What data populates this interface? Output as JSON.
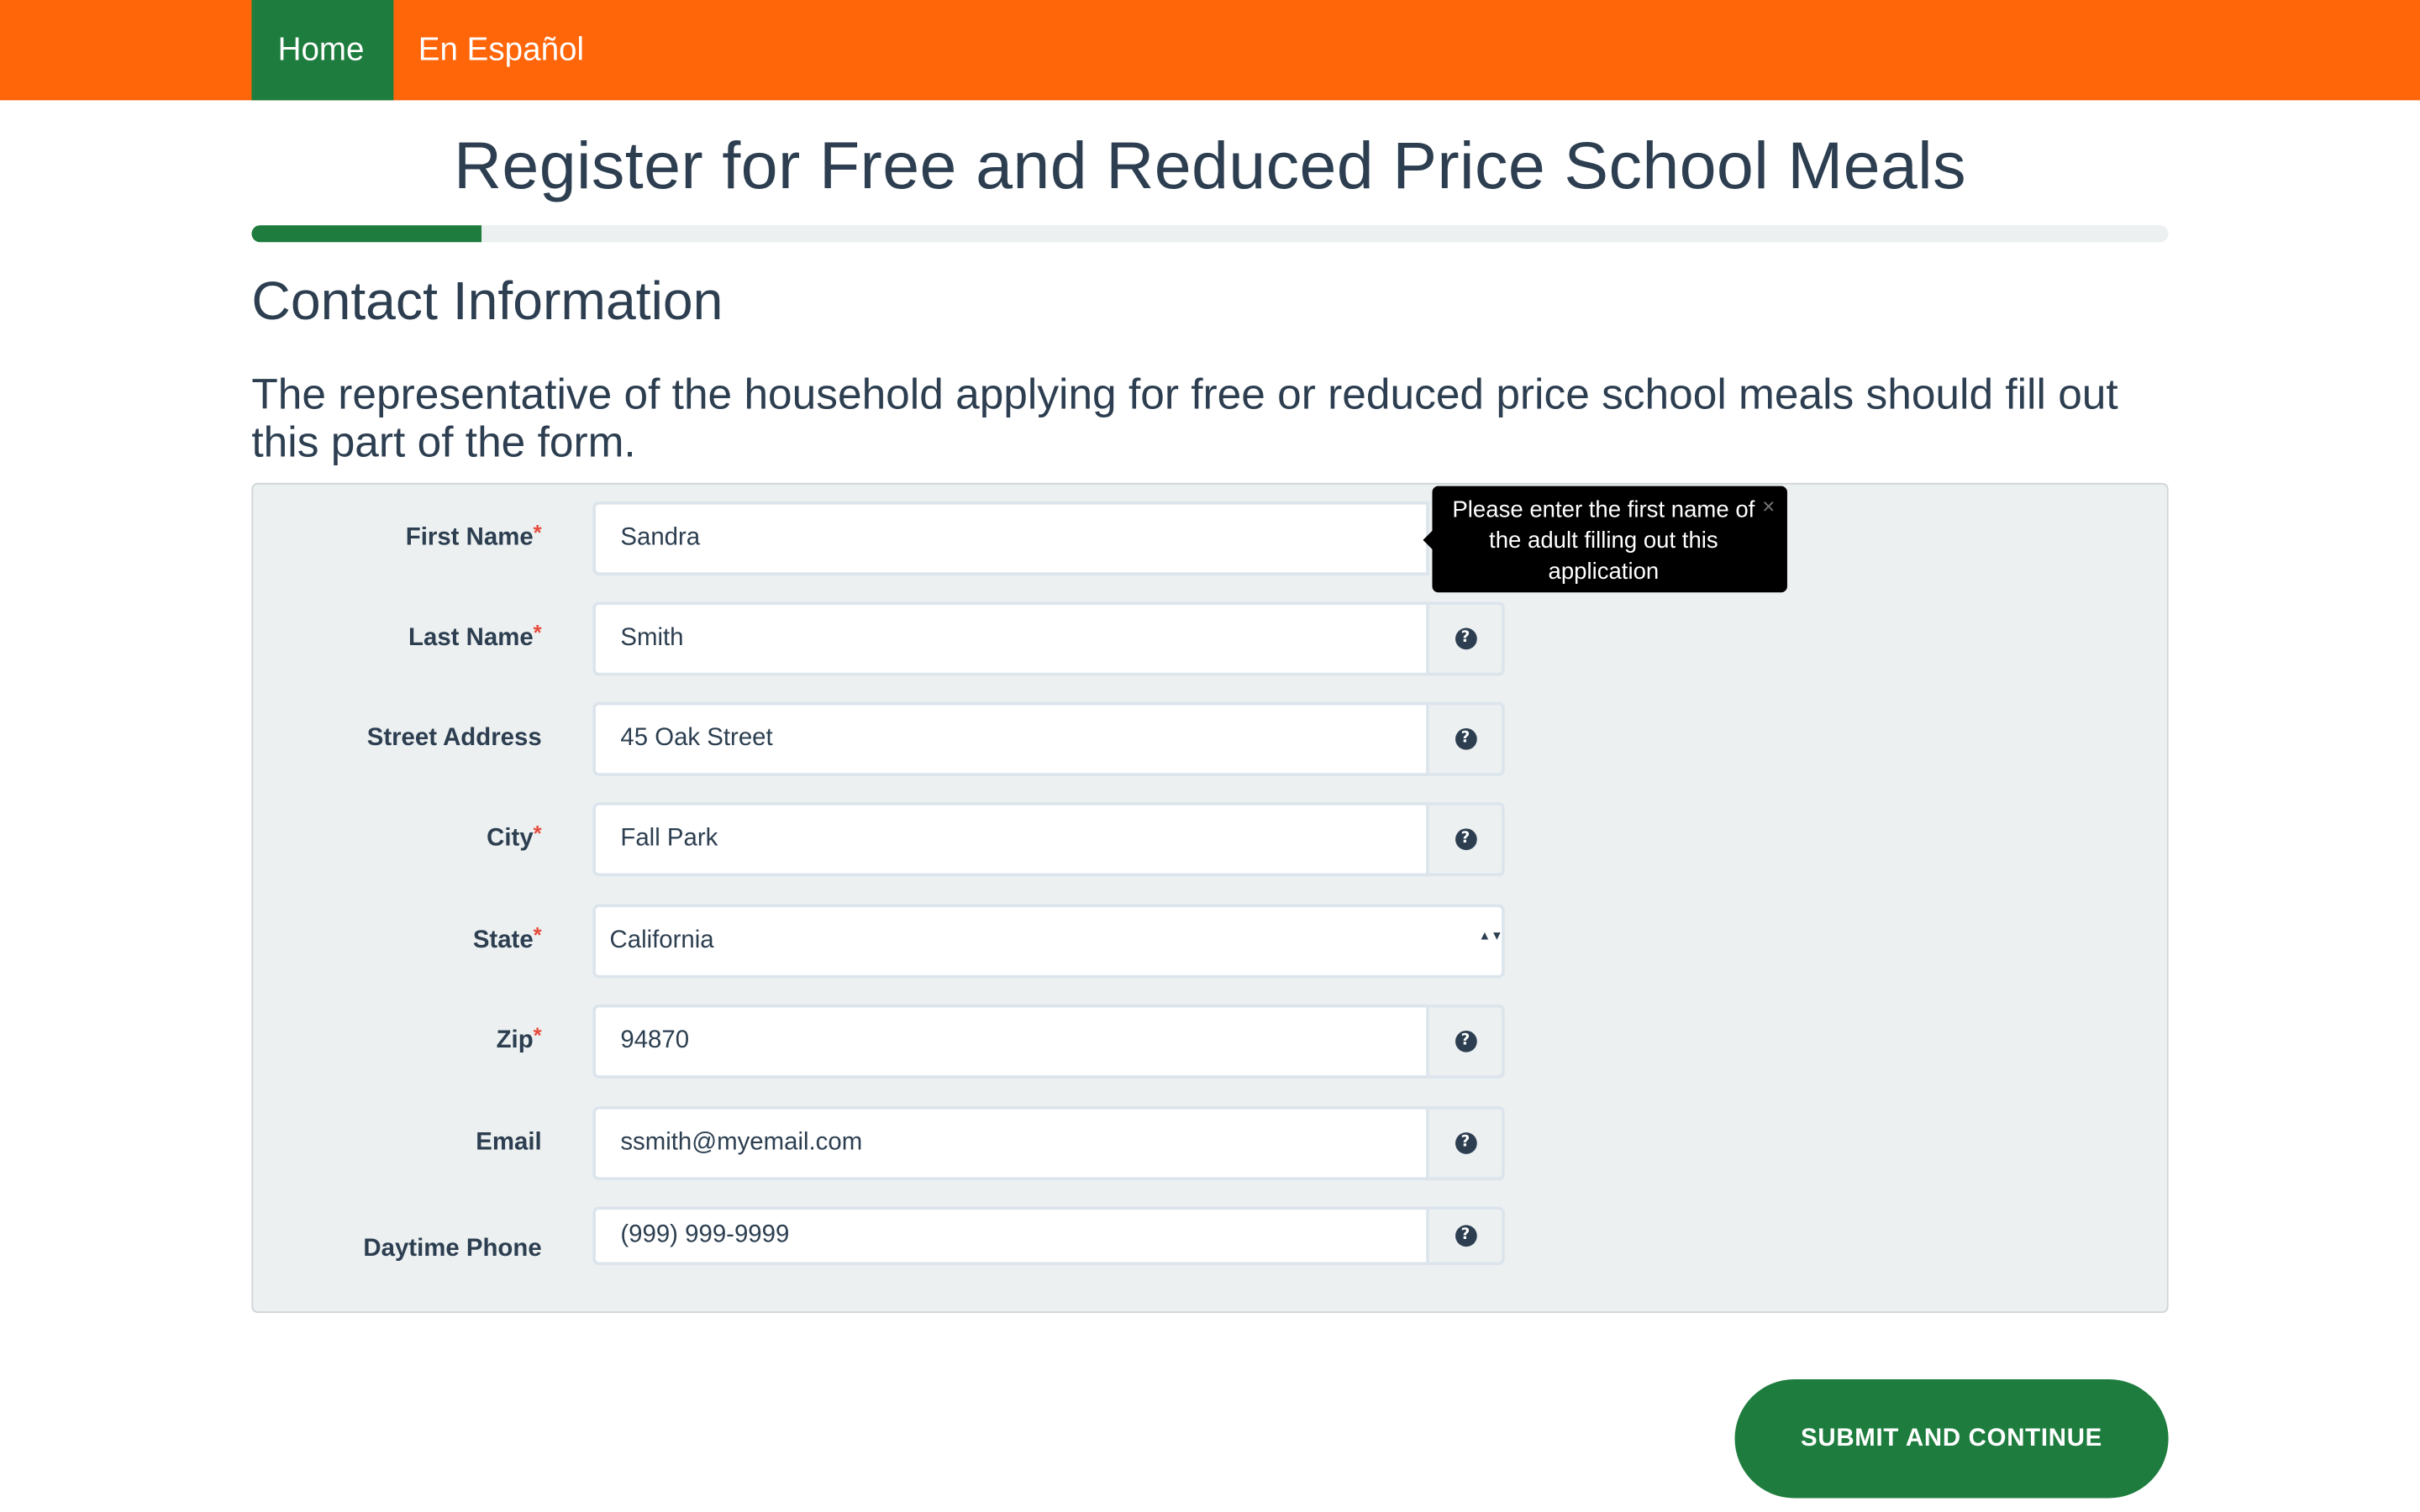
{
  "nav": {
    "home_label": "Home",
    "spanish_label": "En Español"
  },
  "page": {
    "title": "Register for Free and Reduced Price School Meals",
    "progress_fraction": 0.12
  },
  "section": {
    "title": "Contact Information",
    "lead": "The representative of the household applying for free or reduced price school meals should fill out this part of the form."
  },
  "form": {
    "required_marker": "*",
    "first_name": {
      "label": "First Name",
      "value": "Sandra"
    },
    "last_name": {
      "label": "Last Name",
      "value": "Smith"
    },
    "street": {
      "label": "Street Address",
      "value": "45 Oak Street"
    },
    "city": {
      "label": "City",
      "value": "Fall Park"
    },
    "state": {
      "label": "State",
      "value": "California"
    },
    "zip": {
      "label": "Zip",
      "value": "94870"
    },
    "email": {
      "label": "Email",
      "value": "ssmith@myemail.com"
    },
    "phone": {
      "label": "Daytime Phone",
      "value": "(999) 999-9999"
    }
  },
  "tooltip": {
    "text": "Please enter the first name of the adult filling out this application",
    "close_glyph": "×"
  },
  "icons": {
    "help": "question-circle-icon",
    "help_glyph": "?",
    "select_arrows": "▲▼"
  },
  "colors": {
    "nav_bg": "#ff6509",
    "accent_green": "#1e7d3e",
    "text": "#2c3e50",
    "panel_bg": "#ecf0f1",
    "required": "#e74c3c"
  },
  "actions": {
    "submit_label": "SUBMIT AND CONTINUE"
  }
}
